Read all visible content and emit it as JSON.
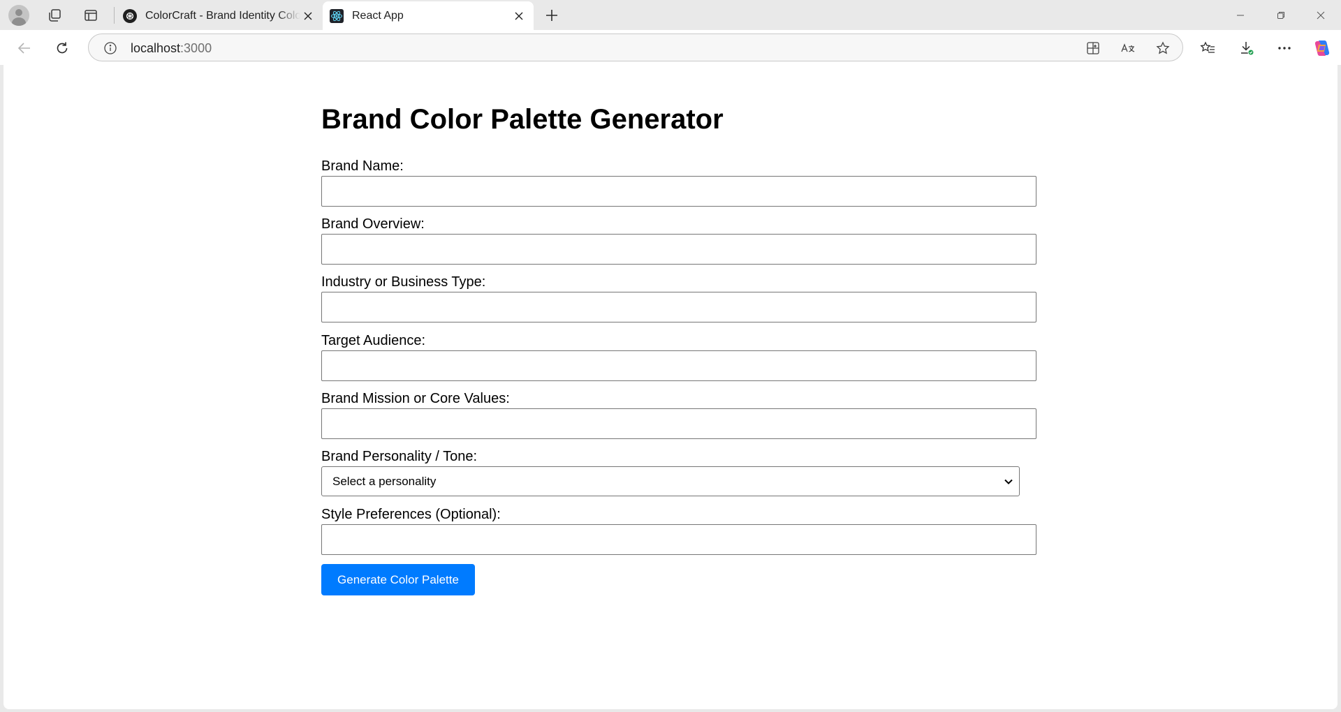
{
  "browser": {
    "tabs": [
      {
        "title": "ColorCraft - Brand Identity Color Palette Generator",
        "favicon": "openai-icon",
        "active": false
      },
      {
        "title": "React App",
        "favicon": "react-icon",
        "active": true
      }
    ],
    "address_bar": {
      "host": "localhost",
      "port": ":3000"
    }
  },
  "page": {
    "title": "Brand Color Palette Generator",
    "fields": [
      {
        "label": "Brand Name:",
        "type": "text",
        "value": ""
      },
      {
        "label": "Brand Overview:",
        "type": "text",
        "value": ""
      },
      {
        "label": "Industry or Business Type:",
        "type": "text",
        "value": ""
      },
      {
        "label": "Target Audience:",
        "type": "text",
        "value": ""
      },
      {
        "label": "Brand Mission or Core Values:",
        "type": "text",
        "value": ""
      },
      {
        "label": "Brand Personality / Tone:",
        "type": "select",
        "selected": "Select a personality"
      },
      {
        "label": "Style Preferences (Optional):",
        "type": "text",
        "value": ""
      }
    ],
    "submit_label": "Generate Color Palette"
  },
  "colors": {
    "accent": "#007bff",
    "page_bg": "#ffffff",
    "chrome_bg": "#e9e9e9",
    "download_badge": "#1e9e4f"
  }
}
